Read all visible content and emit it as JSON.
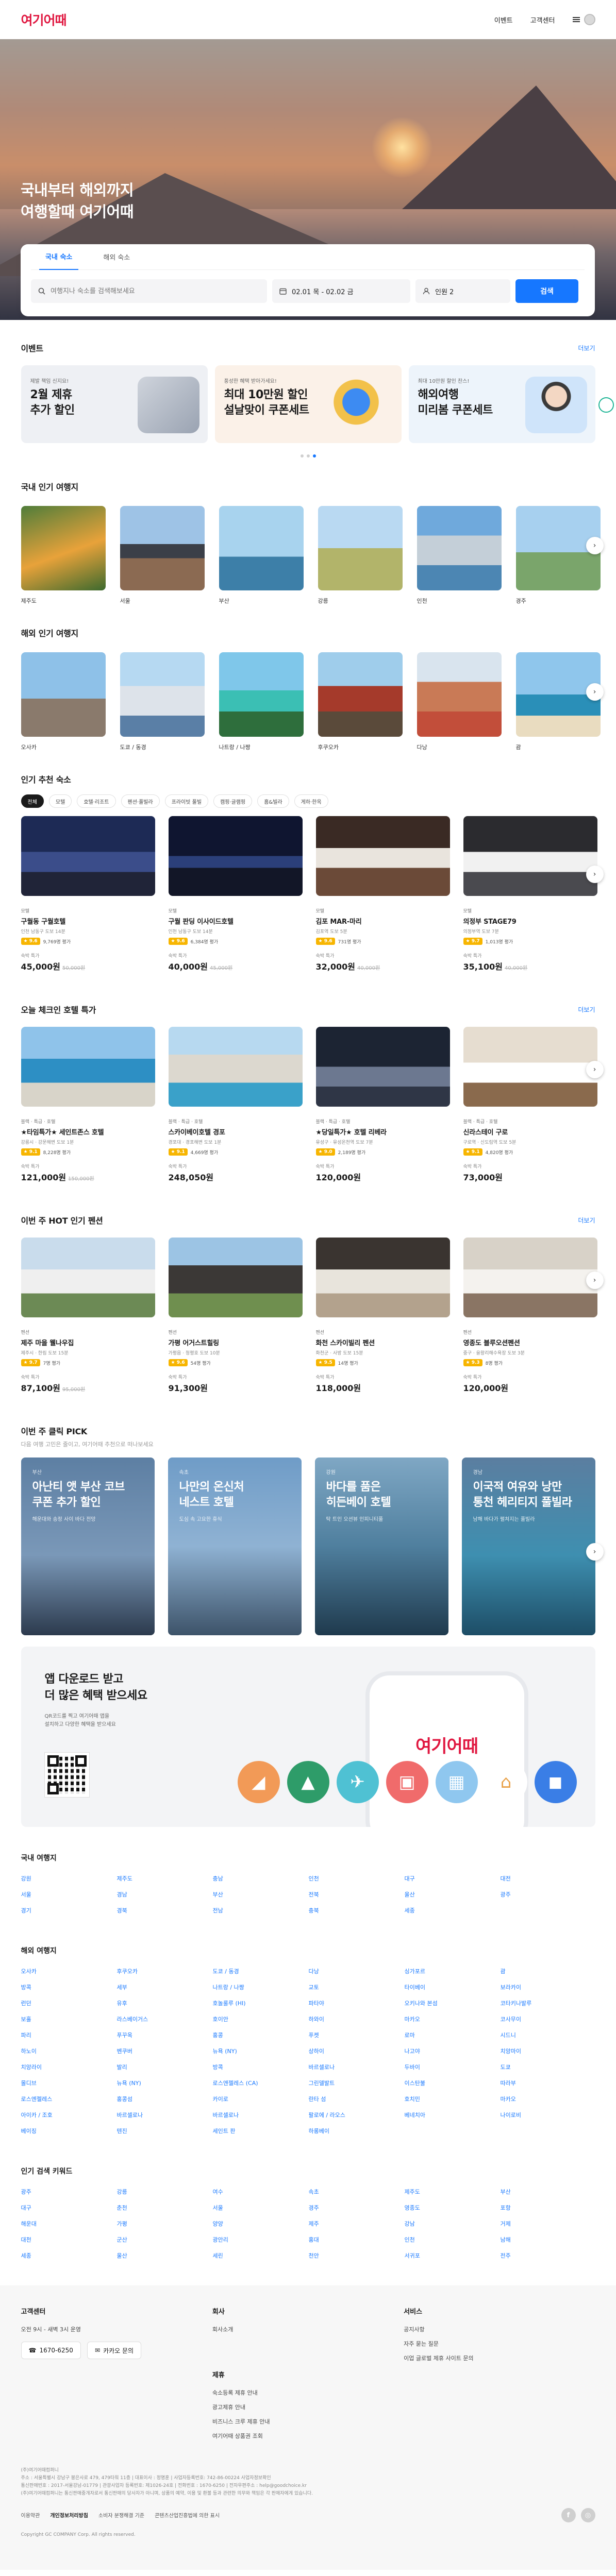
{
  "header": {
    "logo": "여기어때",
    "nav": [
      "이벤트",
      "고객센터"
    ]
  },
  "hero": {
    "title_line1": "국내부터 해외까지",
    "title_line2": "여행할때 여기어때",
    "tabs": [
      "국내 숙소",
      "해외 숙소"
    ],
    "search_placeholder": "여행지나 숙소를 검색해보세요",
    "dates": "02.01 목 - 02.02 금",
    "guests": "인원 2",
    "search_button": "검색"
  },
  "events": {
    "title": "이벤트",
    "more": "더보기",
    "items": [
      {
        "small": "제발 책임 신지요!",
        "line1": "2월 제휴",
        "line2": "추가 할인"
      },
      {
        "small": "풍성한 혜택 받아가세요!",
        "line1": "최대 10만원 할인",
        "line2": "설날맞이 쿠폰세트"
      },
      {
        "small": "최대 10만원 할인 찬스!",
        "line1": "해외여행",
        "line2": "미리봄 쿠폰세트"
      }
    ]
  },
  "domestic_popular": {
    "title": "국내 인기 여행지",
    "items": [
      "제주도",
      "서울",
      "부산",
      "강릉",
      "인천",
      "경주"
    ]
  },
  "overseas_popular": {
    "title": "해외 인기 여행지",
    "items": [
      "오사카",
      "도쿄 / 동경",
      "나트랑 / 나짱",
      "후쿠오카",
      "다낭",
      "괌"
    ]
  },
  "recommend": {
    "title": "인기 추천 숙소",
    "filters": [
      "전체",
      "모텔",
      "호텔·리조트",
      "펜션·풀빌라",
      "프라이빗 풀빌",
      "캠핑·글램핑",
      "홈&빌라",
      "게하·한옥"
    ],
    "cards": [
      {
        "cat": "모텔",
        "name": "구월동 구월호텔",
        "loc": "인천 남동구 도보 14분",
        "score": "9.6",
        "reviews": "9,769명 평가",
        "tag": "숙박 특가",
        "price": "45,000원",
        "orig": "50,000원"
      },
      {
        "cat": "모텔",
        "name": "구월 판딩 이사이드호텔",
        "loc": "인천 남동구 도보 14분",
        "score": "9.6",
        "reviews": "6,384명 평가",
        "tag": "숙박 특가",
        "price": "40,000원",
        "orig": "45,000원"
      },
      {
        "cat": "모텔",
        "name": "김포 MAR-마리",
        "loc": "김포역 도보 5분",
        "score": "9.6",
        "reviews": "731명 평가",
        "tag": "숙박 특가",
        "price": "32,000원",
        "orig": "40,000원"
      },
      {
        "cat": "모텔",
        "name": "의정부 STAGE79",
        "loc": "의정부역 도보 7분",
        "score": "9.7",
        "reviews": "1,013명 평가",
        "tag": "숙박 특가",
        "price": "35,100원",
        "orig": "40,000원"
      }
    ]
  },
  "hotel_deal": {
    "title": "오늘 체크인 호텔 특가",
    "more": "더보기",
    "cards": [
      {
        "cat": "블랙 · 특급 · 호텔",
        "name": "★타임특가★ 세인트존스 호텔",
        "loc": "강릉시 · 강문해변 도보 1분",
        "score": "9.1",
        "reviews": "8,228명 평가",
        "tag": "숙박 특가",
        "price": "121,000원",
        "orig": "150,000원"
      },
      {
        "cat": "블랙 · 특급 · 호텔",
        "name": "스카이베이호텔 경포",
        "loc": "경포대 · 경포해변 도보 1분",
        "score": "9.1",
        "reviews": "4,669명 평가",
        "tag": "숙박 특가",
        "price": "248,050원",
        "orig": ""
      },
      {
        "cat": "블랙 · 특급 · 호텔",
        "name": "★당일특가★ 호텔 리베라",
        "loc": "유성구 · 유성온천역 도보 7분",
        "score": "9.0",
        "reviews": "2,189명 평가",
        "tag": "숙박 특가",
        "price": "120,000원",
        "orig": ""
      },
      {
        "cat": "블랙 · 특급 · 호텔",
        "name": "신라스테이 구로",
        "loc": "구로역 · 신도림역 도보 5분",
        "score": "9.1",
        "reviews": "4,820명 평가",
        "tag": "숙박 특가",
        "price": "73,000원",
        "orig": ""
      }
    ]
  },
  "pension": {
    "title": "이번 주 HOT 인기 펜션",
    "more": "더보기",
    "cards": [
      {
        "cat": "펜션",
        "name": "제주 마을 웰나우집",
        "loc": "제주시 · 한림 도보 15분",
        "score": "9.7",
        "reviews": "7명 평가",
        "tag": "숙박 특가",
        "price": "87,100원",
        "orig": "95,000원"
      },
      {
        "cat": "펜션",
        "name": "가평 어거스트힐링",
        "loc": "가평읍 · 청평호 도보 10분",
        "score": "9.6",
        "reviews": "54명 평가",
        "tag": "숙박 특가",
        "price": "91,300원",
        "orig": ""
      },
      {
        "cat": "펜션",
        "name": "화천 스카이빌리 펜션",
        "loc": "화천군 · 사방 도보 15분",
        "score": "9.5",
        "reviews": "14명 평가",
        "tag": "숙박 특가",
        "price": "118,000원",
        "orig": ""
      },
      {
        "cat": "펜션",
        "name": "영종도 블루오션펜션",
        "loc": "중구 · 을왕리해수욕장 도보 3분",
        "score": "9.3",
        "reviews": "8명 평가",
        "tag": "숙박 특가",
        "price": "120,000원",
        "orig": ""
      }
    ]
  },
  "pick": {
    "title": "이번 주 클릭 PICK",
    "sub": "다음 여행 고민은 줄이고, 여기어때 추천으로 떠나보세요",
    "items": [
      {
        "k": "부산",
        "t1": "아난티 앳 부산 코브",
        "t2": "쿠폰 추가 할인",
        "d": "해운대와 송정 사이 바다 전망"
      },
      {
        "k": "속초",
        "t1": "나만의 온신처",
        "t2": "네스트 호텔",
        "d": "도심 속 고요한 휴식"
      },
      {
        "k": "강원",
        "t1": "바다를 품은",
        "t2": "히든베이 호텔",
        "d": "탁 트인 오션뷰 인피니티풀"
      },
      {
        "k": "경남",
        "t1": "이국적 여유와 낭만",
        "t2": "통천 헤리티지 풀빌라",
        "d": "남해 바다가 펼쳐지는 풀빌라"
      }
    ]
  },
  "app": {
    "title_line1": "앱 다운로드 받고",
    "title_line2": "더 많은 혜택 받으세요",
    "desc_line1": "QR코드를 찍고 여기어때 앱을",
    "desc_line2": "설치하고 다양한 혜택을 받으세요",
    "phone_logo": "여기어때"
  },
  "domestic_dir": {
    "title": "국내 여행지",
    "items": [
      "강원",
      "제주도",
      "충남",
      "인천",
      "대구",
      "대전",
      "서울",
      "경남",
      "부산",
      "전북",
      "울산",
      "광주",
      "경기",
      "경북",
      "전남",
      "충북",
      "세종"
    ]
  },
  "overseas_dir": {
    "title": "해외 여행지",
    "items": [
      "오사카",
      "후쿠오카",
      "도쿄 / 동경",
      "다낭",
      "싱가포르",
      "괌",
      "방콕",
      "세부",
      "나트랑 / 나짱",
      "교토",
      "타이베이",
      "보라카이",
      "런던",
      "유후",
      "호놀룰루 (HI)",
      "파타야",
      "오키나와 본섬",
      "코타키나발루",
      "보홀",
      "라스베이거스",
      "호이안",
      "하와이",
      "마카오",
      "코사무이",
      "파리",
      "푸꾸옥",
      "홍콩",
      "푸켓",
      "로마",
      "시드니",
      "하노이",
      "벤쿠버",
      "뉴욕 (NY)",
      "상하이",
      "나고야",
      "치앙마이",
      "치앙라이",
      "발리",
      "방콕",
      "바르셀로나",
      "두바이",
      "도쿄",
      "몰디브",
      "뉴욕 (NY)",
      "로스앤젤레스 (CA)",
      "그린델발트",
      "이스탄불",
      "따라부",
      "로스엔젤레스",
      "홍콩섬",
      "카이로",
      "란타 섬",
      "호치민",
      "마카오",
      "아이카 / 조호",
      "바르셀로나",
      "바르셀로나",
      "팔로에 / 라오스",
      "베네치아",
      "나이로비",
      "베이징",
      "텐진",
      "세인트 판",
      "하롱베이"
    ]
  },
  "keywords": {
    "title": "인기 검색 키워드",
    "items": [
      "광주",
      "강릉",
      "여수",
      "속초",
      "제주도",
      "부산",
      "대구",
      "춘천",
      "서울",
      "경주",
      "영종도",
      "포항",
      "해운대",
      "가평",
      "양양",
      "제주",
      "강남",
      "거제",
      "대천",
      "군산",
      "광안리",
      "홍대",
      "인천",
      "남해",
      "세종",
      "울산",
      "세린",
      "천안",
      "서귀포",
      "전주"
    ]
  },
  "footer": {
    "cs_title": "고객센터",
    "cs_hours": "오전 9시 - 새벽 3시 운영",
    "phone_btn": "1670-6250",
    "kakao_btn": "카카오 문의",
    "company_title": "회사",
    "company_items": [
      "회사소개"
    ],
    "service_title": "서비스",
    "service_items": [
      "공지사항",
      "자주 묻는 질문",
      "이업 글로벌 제휴 사이트 문의"
    ],
    "partner_title": "제휴",
    "partner_items": [
      "숙소등록 제휴 안내",
      "광고제휴 안내",
      "비즈니스 크루 제휴 안내",
      "여기어때 상품권 조회"
    ],
    "company_name": "(주)여기어때컴퍼니",
    "legal_line1": "주소 : 서울특별시 강남구 봉은사로 479, 479타워 11층 | 대표이사 : 정명훈 | 사업자등록번호: 742-86-00224 사업자정보확인",
    "legal_line2": "통신판매번호 : 2017-서울강남-01779 | 관광사업자 등록번호: 제1026-24호 | 전화번호 : 1670-6250 | 전자우편주소 : help@goodchoice.kr",
    "legal_line3": "(주)여기어때컴퍼니는 통신판매중개자로서 통신판매의 당사자가 아니며, 상품의 예약, 이용 및 환불 등과 관련한 의무와 책임은 각 판매자에게 있습니다.",
    "links": [
      "이용약관",
      "개인정보처리방침",
      "소비자 분쟁해결 기준",
      "콘텐츠산업진흥법에 의한 표시"
    ],
    "copyright": "Copyright GC COMPANY Corp. All rights reserved."
  },
  "colors": {
    "brand": "#e0163f",
    "accent": "#1677ff",
    "rating": "#f7b500"
  }
}
